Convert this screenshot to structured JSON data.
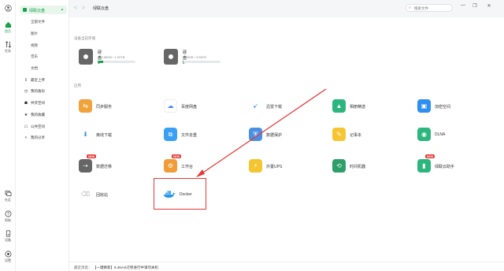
{
  "rail": {
    "items": [
      {
        "label": "",
        "icon": "user-avatar-icon"
      },
      {
        "label": "首页",
        "icon": "home-icon"
      },
      {
        "label": "任务",
        "icon": "transfer-icon"
      }
    ],
    "bottom": [
      {
        "label": "社区",
        "icon": "community-icon"
      },
      {
        "label": "帮助",
        "icon": "help-icon"
      },
      {
        "label": "设备",
        "icon": "device-icon"
      },
      {
        "label": "设置",
        "icon": "settings-icon"
      }
    ]
  },
  "sidebar": {
    "head": "绿联云盘",
    "sub": [
      "全部文件",
      "图片",
      "视频",
      "音乐",
      "文档"
    ],
    "items": [
      {
        "label": "最近上传",
        "icon": "↥"
      },
      {
        "label": "我的备份",
        "icon": "◷"
      },
      {
        "label": "共享空间",
        "icon": "☗"
      },
      {
        "label": "我的收藏",
        "icon": "★"
      },
      {
        "label": "公共空间",
        "icon": "☖"
      },
      {
        "label": "我的分享",
        "icon": "<"
      }
    ]
  },
  "topbar": {
    "back": "<",
    "forward": ">",
    "breadcrumb": "绿联云盘",
    "search_placeholder": "搜索文件",
    "minimize": "—",
    "restore": "❐",
    "close": "✕",
    "sync": "↻"
  },
  "storage": {
    "section_label": "设备当前存储",
    "disks": [
      {
        "name": "硬盘1",
        "size": "262.68GB / 1.93TB",
        "used_fraction": 0.14
      },
      {
        "name": "硬盘2",
        "size": "3.95GB / 3.56TB",
        "used_fraction": 0.02
      }
    ]
  },
  "apps": {
    "section_label": "应用",
    "items": [
      {
        "label": "同步服务",
        "color": "#f0a23b",
        "glyph": "⇆",
        "badge": ""
      },
      {
        "label": "百度网盘",
        "color": "#ffffff",
        "glyph": "☁",
        "badge": ""
      },
      {
        "label": "迅雷下载",
        "color": "#ffffff",
        "glyph": "➹",
        "badge": ""
      },
      {
        "label": "相册精选",
        "color": "#2cb67d",
        "glyph": "▲",
        "badge": ""
      },
      {
        "label": "加密空间",
        "color": "#2f8ff0",
        "glyph": "▣",
        "badge": ""
      },
      {
        "label": "离线下载",
        "color": "#ffffff",
        "glyph": "⬇",
        "badge": ""
      },
      {
        "label": "文件去重",
        "color": "#3aa0f3",
        "glyph": "⧉",
        "badge": ""
      },
      {
        "label": "数据保护",
        "color": "#4a90e2",
        "glyph": "⛨",
        "badge": ""
      },
      {
        "label": "记事本",
        "color": "#f7c531",
        "glyph": "✎",
        "badge": ""
      },
      {
        "label": "DLNA",
        "color": "#2cb67d",
        "glyph": "◉",
        "badge": ""
      },
      {
        "label": "数据迁移",
        "color": "#666666",
        "glyph": "⇢",
        "badge": "NEW"
      },
      {
        "label": "工作台",
        "color": "#f09c37",
        "glyph": "⚙",
        "badge": "NEW"
      },
      {
        "label": "外置UPS",
        "color": "#f3c530",
        "glyph": "⚡",
        "badge": ""
      },
      {
        "label": "时间机器",
        "color": "#2e9e6a",
        "glyph": "⟲",
        "badge": ""
      },
      {
        "label": "绿联云助手",
        "color": "#2cb67d",
        "glyph": "▮",
        "badge": "NEW"
      },
      {
        "label": "回收站",
        "color": "#ffffff",
        "glyph": "⌫",
        "badge": ""
      },
      {
        "label": "Docker",
        "color": "#ffffff",
        "glyph": "🐳",
        "badge": ""
      }
    ]
  },
  "status": {
    "label": "最近消息：",
    "message": "【一键换新】6.4NAS迁移进行中请勿关机"
  }
}
